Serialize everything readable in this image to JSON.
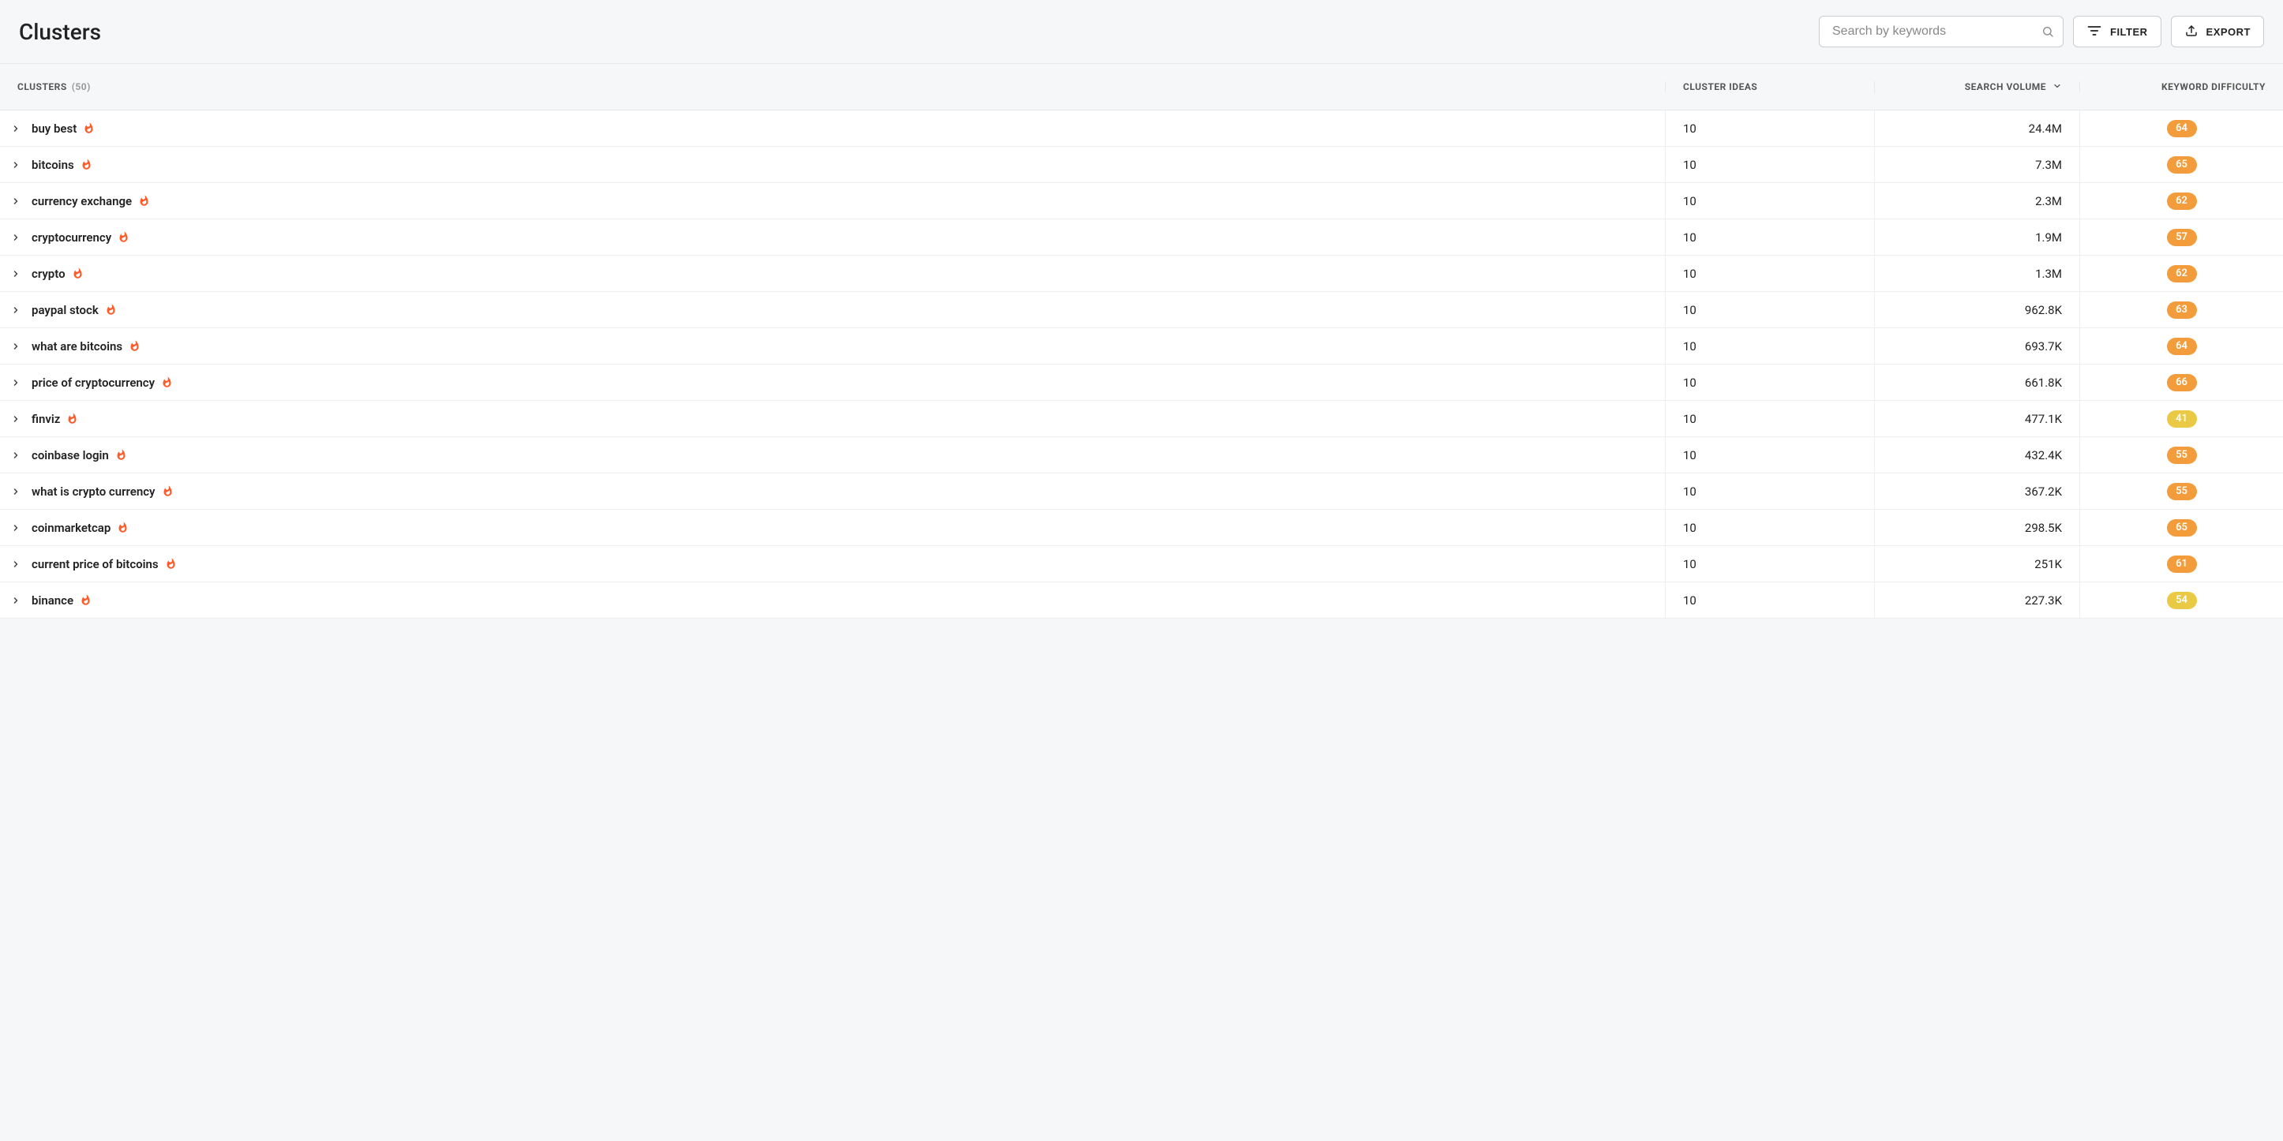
{
  "header": {
    "title": "Clusters",
    "search": {
      "placeholder": "Search by keywords"
    },
    "filter_label": "FILTER",
    "export_label": "EXPORT"
  },
  "columns": {
    "clusters": "CLUSTERS",
    "clusters_count": "(50)",
    "ideas": "CLUSTER IDEAS",
    "volume": "SEARCH VOLUME",
    "difficulty": "KEYWORD DIFFICULTY"
  },
  "rows": [
    {
      "name": "buy best",
      "trending": true,
      "ideas": "10",
      "volume": "24.4M",
      "difficulty": "64",
      "difficulty_color": "orange"
    },
    {
      "name": "bitcoins",
      "trending": true,
      "ideas": "10",
      "volume": "7.3M",
      "difficulty": "65",
      "difficulty_color": "orange"
    },
    {
      "name": "currency exchange",
      "trending": true,
      "ideas": "10",
      "volume": "2.3M",
      "difficulty": "62",
      "difficulty_color": "orange"
    },
    {
      "name": "cryptocurrency",
      "trending": true,
      "ideas": "10",
      "volume": "1.9M",
      "difficulty": "57",
      "difficulty_color": "orange"
    },
    {
      "name": "crypto",
      "trending": true,
      "ideas": "10",
      "volume": "1.3M",
      "difficulty": "62",
      "difficulty_color": "orange"
    },
    {
      "name": "paypal stock",
      "trending": true,
      "ideas": "10",
      "volume": "962.8K",
      "difficulty": "63",
      "difficulty_color": "orange"
    },
    {
      "name": "what are bitcoins",
      "trending": true,
      "ideas": "10",
      "volume": "693.7K",
      "difficulty": "64",
      "difficulty_color": "orange"
    },
    {
      "name": "price of cryptocurrency",
      "trending": true,
      "ideas": "10",
      "volume": "661.8K",
      "difficulty": "66",
      "difficulty_color": "orange"
    },
    {
      "name": "finviz",
      "trending": true,
      "ideas": "10",
      "volume": "477.1K",
      "difficulty": "41",
      "difficulty_color": "yellow"
    },
    {
      "name": "coinbase login",
      "trending": true,
      "ideas": "10",
      "volume": "432.4K",
      "difficulty": "55",
      "difficulty_color": "orange"
    },
    {
      "name": "what is crypto currency",
      "trending": true,
      "ideas": "10",
      "volume": "367.2K",
      "difficulty": "55",
      "difficulty_color": "orange"
    },
    {
      "name": "coinmarketcap",
      "trending": true,
      "ideas": "10",
      "volume": "298.5K",
      "difficulty": "65",
      "difficulty_color": "orange"
    },
    {
      "name": "current price of bitcoins",
      "trending": true,
      "ideas": "10",
      "volume": "251K",
      "difficulty": "61",
      "difficulty_color": "orange"
    },
    {
      "name": "binance",
      "trending": true,
      "ideas": "10",
      "volume": "227.3K",
      "difficulty": "54",
      "difficulty_color": "yellow"
    }
  ]
}
